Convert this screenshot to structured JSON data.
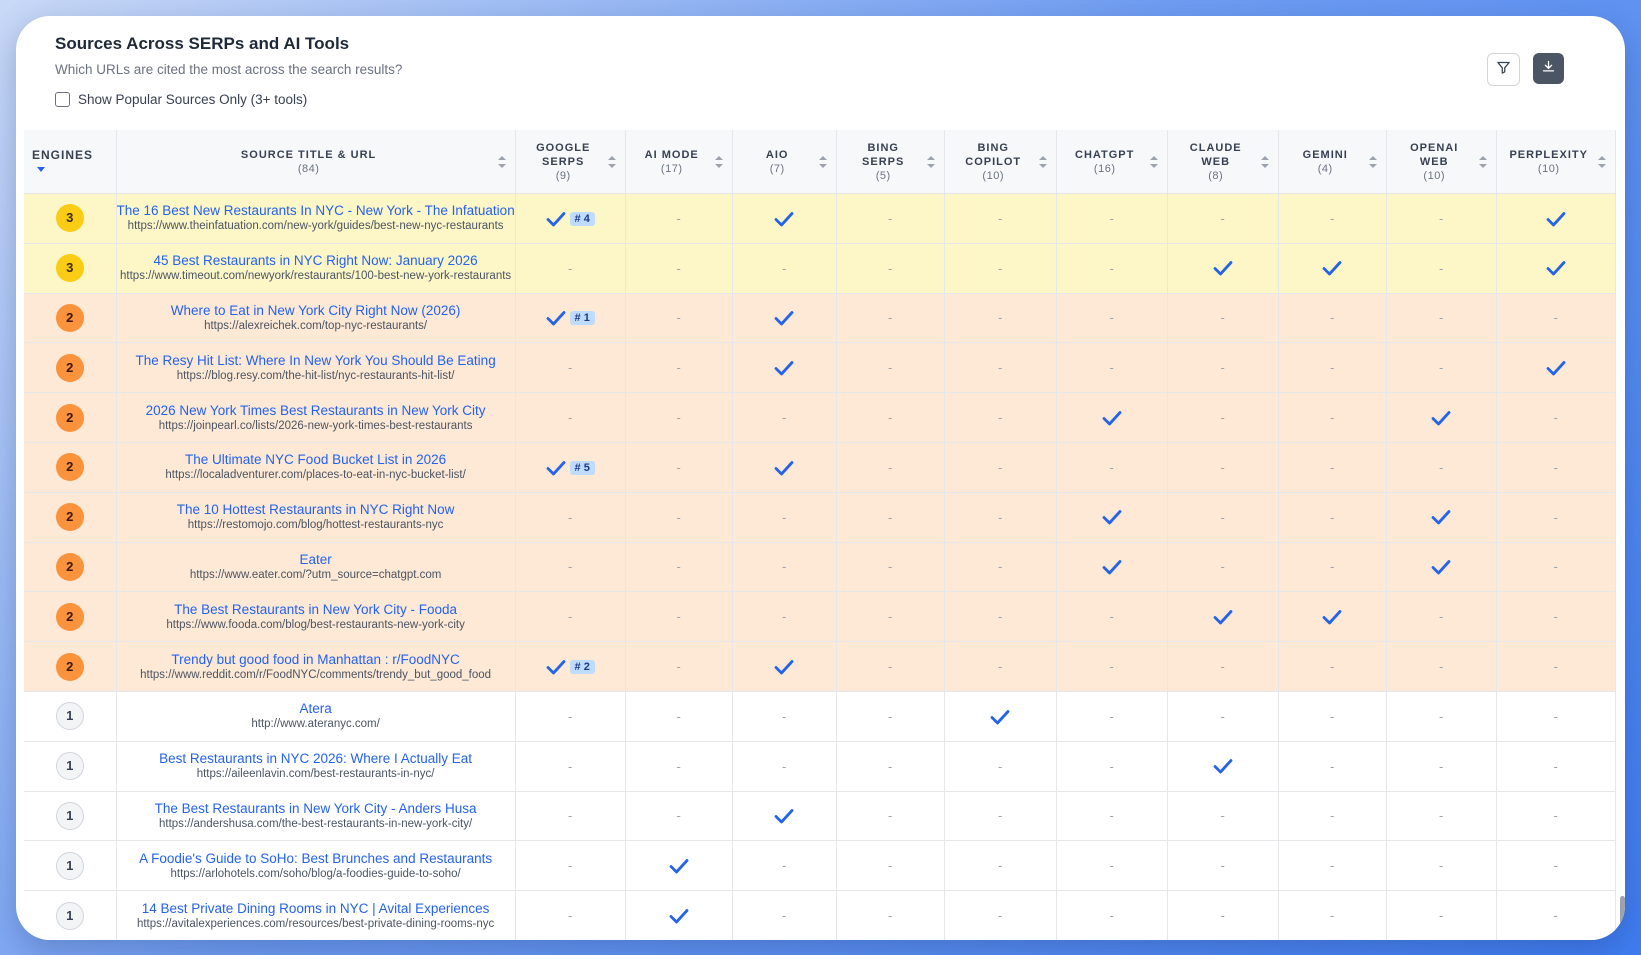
{
  "header": {
    "title": "Sources Across SERPs and AI Tools",
    "subtitle": "Which URLs are cited the most across the search results?",
    "toggle_label": "Show Popular Sources Only (3+ tools)"
  },
  "icons": {
    "filter": "filter-icon",
    "download": "download-icon",
    "check": "checkmark-icon"
  },
  "colors": {
    "accent": "#2563eb",
    "level3": "#fdf6c7",
    "level2": "#fde9d5",
    "badge3": "#facc15",
    "badge2": "#fb923c"
  },
  "table": {
    "engines_header": "ENGINES",
    "source_header": "SOURCE TITLE & URL",
    "source_count": "(84)",
    "columns": [
      {
        "l1": "GOOGLE",
        "l2": "SERPS",
        "count": "(9)"
      },
      {
        "l1": "AI MODE",
        "l2": "",
        "count": "(17)"
      },
      {
        "l1": "AIO",
        "l2": "",
        "count": "(7)"
      },
      {
        "l1": "BING",
        "l2": "SERPS",
        "count": "(5)"
      },
      {
        "l1": "BING",
        "l2": "COPILOT",
        "count": "(10)"
      },
      {
        "l1": "CHATGPT",
        "l2": "",
        "count": "(16)"
      },
      {
        "l1": "CLAUDE",
        "l2": "WEB",
        "count": "(8)"
      },
      {
        "l1": "GEMINI",
        "l2": "",
        "count": "(4)"
      },
      {
        "l1": "OPENAI",
        "l2": "WEB",
        "count": "(10)"
      },
      {
        "l1": "PERPLEXITY",
        "l2": "",
        "count": "(10)"
      }
    ],
    "dash": "-",
    "rows": [
      {
        "engines": "3",
        "level": 3,
        "title": "The 16 Best New Restaurants In NYC - New York - The Infatuation",
        "url": "https://www.theinfatuation.com/new-york/guides/best-new-nyc-restaurants",
        "cells": [
          "#4",
          "",
          "x",
          "",
          "",
          "",
          "",
          "",
          "",
          "x"
        ]
      },
      {
        "engines": "3",
        "level": 3,
        "title": "45 Best Restaurants in NYC Right Now: January 2026",
        "url": "https://www.timeout.com/newyork/restaurants/100-best-new-york-restaurants",
        "cells": [
          "",
          "",
          "",
          "",
          "",
          "",
          "x",
          "x",
          "",
          "x"
        ]
      },
      {
        "engines": "2",
        "level": 2,
        "title": "Where to Eat in New York City Right Now (2026)",
        "url": "https://alexreichek.com/top-nyc-restaurants/",
        "cells": [
          "#1",
          "",
          "x",
          "",
          "",
          "",
          "",
          "",
          "",
          ""
        ]
      },
      {
        "engines": "2",
        "level": 2,
        "title": "The Resy Hit List: Where In New York You Should Be Eating",
        "url": "https://blog.resy.com/the-hit-list/nyc-restaurants-hit-list/",
        "cells": [
          "",
          "",
          "x",
          "",
          "",
          "",
          "",
          "",
          "",
          "x"
        ]
      },
      {
        "engines": "2",
        "level": 2,
        "title": "2026 New York Times Best Restaurants in New York City",
        "url": "https://joinpearl.co/lists/2026-new-york-times-best-restaurants",
        "cells": [
          "",
          "",
          "",
          "",
          "",
          "x",
          "",
          "",
          "x",
          ""
        ]
      },
      {
        "engines": "2",
        "level": 2,
        "title": "The Ultimate NYC Food Bucket List in 2026",
        "url": "https://localadventurer.com/places-to-eat-in-nyc-bucket-list/",
        "cells": [
          "#5",
          "",
          "x",
          "",
          "",
          "",
          "",
          "",
          "",
          ""
        ]
      },
      {
        "engines": "2",
        "level": 2,
        "title": "The 10 Hottest Restaurants in NYC Right Now",
        "url": "https://restomojo.com/blog/hottest-restaurants-nyc",
        "cells": [
          "",
          "",
          "",
          "",
          "",
          "x",
          "",
          "",
          "x",
          ""
        ]
      },
      {
        "engines": "2",
        "level": 2,
        "title": "Eater",
        "url": "https://www.eater.com/?utm_source=chatgpt.com",
        "cells": [
          "",
          "",
          "",
          "",
          "",
          "x",
          "",
          "",
          "x",
          ""
        ]
      },
      {
        "engines": "2",
        "level": 2,
        "title": "The Best Restaurants in New York City - Fooda",
        "url": "https://www.fooda.com/blog/best-restaurants-new-york-city",
        "cells": [
          "",
          "",
          "",
          "",
          "",
          "",
          "x",
          "x",
          "",
          ""
        ]
      },
      {
        "engines": "2",
        "level": 2,
        "title": "Trendy but good food in Manhattan : r/FoodNYC",
        "url": "https://www.reddit.com/r/FoodNYC/comments/trendy_but_good_food",
        "cells": [
          "#2",
          "",
          "x",
          "",
          "",
          "",
          "",
          "",
          "",
          ""
        ]
      },
      {
        "engines": "1",
        "level": 1,
        "title": "Atera",
        "url": "http://www.ateranyc.com/",
        "cells": [
          "",
          "",
          "",
          "",
          "x",
          "",
          "",
          "",
          "",
          ""
        ]
      },
      {
        "engines": "1",
        "level": 1,
        "title": "Best Restaurants in NYC 2026: Where I Actually Eat",
        "url": "https://aileenlavin.com/best-restaurants-in-nyc/",
        "cells": [
          "",
          "",
          "",
          "",
          "",
          "",
          "x",
          "",
          "",
          ""
        ]
      },
      {
        "engines": "1",
        "level": 1,
        "title": "The Best Restaurants in New York City - Anders Husa",
        "url": "https://andershusa.com/the-best-restaurants-in-new-york-city/",
        "cells": [
          "",
          "",
          "x",
          "",
          "",
          "",
          "",
          "",
          "",
          ""
        ]
      },
      {
        "engines": "1",
        "level": 1,
        "title": "A Foodie's Guide to SoHo: Best Brunches and Restaurants",
        "url": "https://arlohotels.com/soho/blog/a-foodies-guide-to-soho/",
        "cells": [
          "",
          "x",
          "",
          "",
          "",
          "",
          "",
          "",
          "",
          ""
        ]
      },
      {
        "engines": "1",
        "level": 1,
        "title": "14 Best Private Dining Rooms in NYC | Avital Experiences",
        "url": "https://avitalexperiences.com/resources/best-private-dining-rooms-nyc",
        "cells": [
          "",
          "x",
          "",
          "",
          "",
          "",
          "",
          "",
          "",
          ""
        ]
      }
    ]
  }
}
